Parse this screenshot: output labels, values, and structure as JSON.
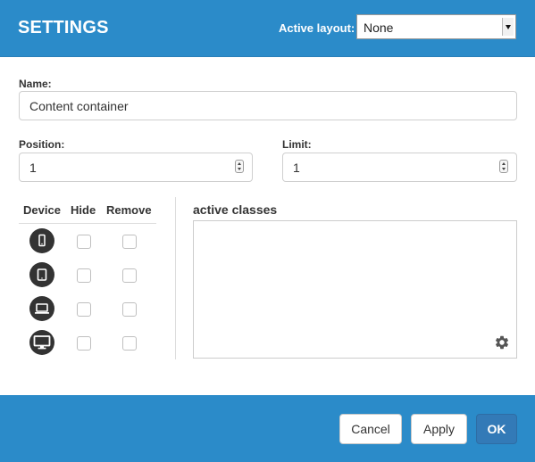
{
  "header": {
    "title": "SETTINGS",
    "layout_label": "Active layout:",
    "layout_value": "None"
  },
  "form": {
    "name_label": "Name:",
    "name_value": "Content container",
    "position_label": "Position:",
    "position_value": "1",
    "limit_label": "Limit:",
    "limit_value": "1"
  },
  "devices": {
    "columns": [
      "Device",
      "Hide",
      "Remove"
    ],
    "rows": [
      {
        "device": "phone-icon",
        "hide": false,
        "remove": false
      },
      {
        "device": "tablet-icon",
        "hide": false,
        "remove": false
      },
      {
        "device": "laptop-icon",
        "hide": false,
        "remove": false
      },
      {
        "device": "desktop-icon",
        "hide": false,
        "remove": false
      }
    ]
  },
  "classes": {
    "label": "active classes",
    "icon": "gear-icon"
  },
  "footer": {
    "cancel_label": "Cancel",
    "apply_label": "Apply",
    "ok_label": "OK"
  },
  "colors": {
    "header_bg": "#2b8bc9",
    "primary_button": "#337ab7",
    "device_icon_bg": "#333333"
  }
}
